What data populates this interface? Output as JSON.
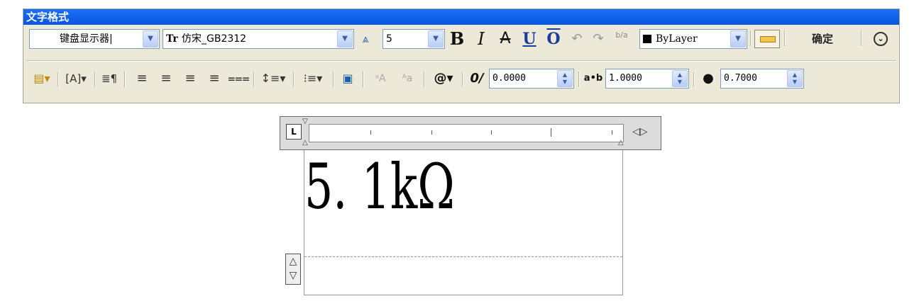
{
  "window": {
    "title": "文字格式"
  },
  "row1": {
    "style_combo": "键盘显示器|",
    "font_combo": "仿宋_GB2312",
    "font_icon_label": "Tr",
    "height_combo": "5",
    "bold": "B",
    "italic": "I",
    "strike": "A",
    "underline": "U",
    "overline": "O",
    "undo": "↶",
    "redo": "↷",
    "stack": "b/a",
    "color_combo": "ByLayer",
    "ok_button": "确定",
    "options_button": "⌄"
  },
  "row2": {
    "oblique_value": "0.0000",
    "tracking_value": "1.0000",
    "width_value": "0.7000",
    "symbol_button": "@▾",
    "tracking_label": "a•b"
  },
  "editor": {
    "text": "5. 1kΩ",
    "tab_type": "L",
    "ruler_arrows": "◁▷"
  }
}
